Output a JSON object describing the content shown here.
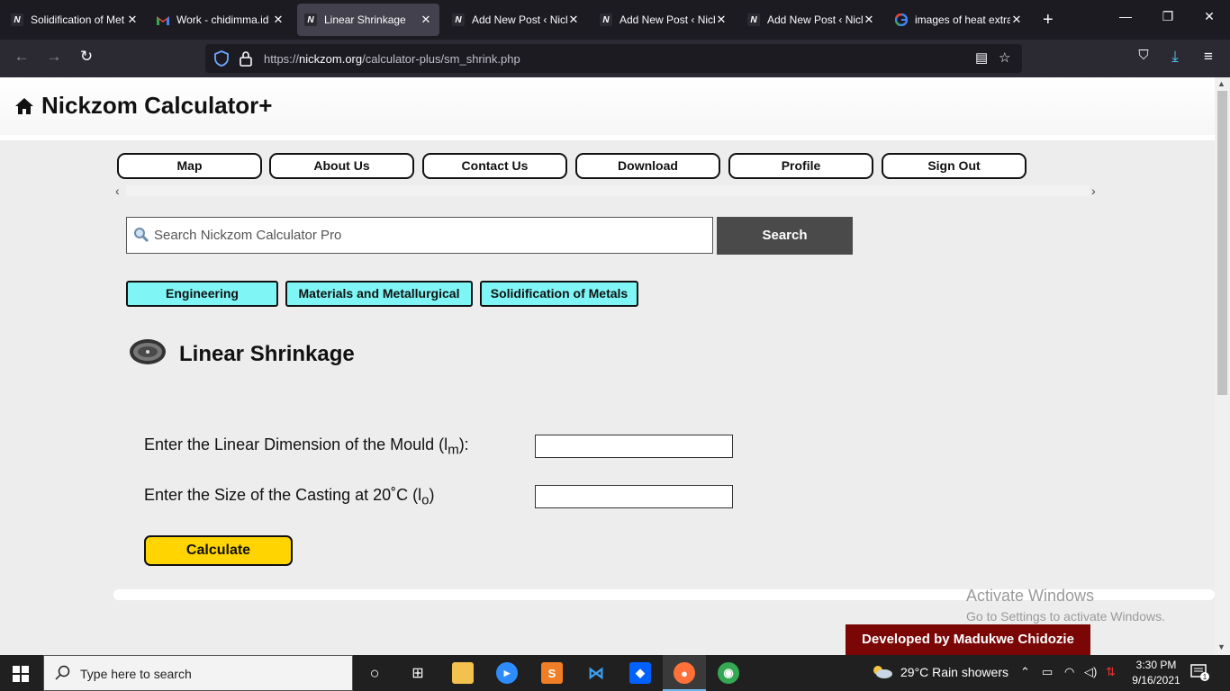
{
  "browser": {
    "tabs": [
      {
        "title": "Solidification of Met",
        "favicon": "nickzom"
      },
      {
        "title": "Work - chidimma.id",
        "favicon": "gmail"
      },
      {
        "title": "Linear Shrinkage",
        "favicon": "nickzom",
        "active": true
      },
      {
        "title": "Add New Post ‹ Nicl",
        "favicon": "nickzom"
      },
      {
        "title": "Add New Post ‹ Nicl",
        "favicon": "nickzom"
      },
      {
        "title": "Add New Post ‹ Nicl",
        "favicon": "nickzom"
      },
      {
        "title": "images of heat extra",
        "favicon": "google"
      }
    ],
    "url_prefix": "https://",
    "url_host": "nickzom.org",
    "url_path": "/calculator-plus/sm_shrink.php"
  },
  "site": {
    "title": "Nickzom Calculator+"
  },
  "menu": [
    "Map",
    "About Us",
    "Contact Us",
    "Download",
    "Profile",
    "Sign Out"
  ],
  "search": {
    "placeholder": "Search Nickzom Calculator Pro",
    "button": "Search"
  },
  "breadcrumbs": [
    "Engineering",
    "Materials and Metallurgical",
    "Solidification of Metals"
  ],
  "calculator": {
    "title": "Linear Shrinkage",
    "field1_label": "Enter the Linear Dimension of the Mould (l",
    "field1_sub": "m",
    "field1_tail": "):",
    "field2_label": "Enter the Size of the Casting at 20˚C (l",
    "field2_sub": "o",
    "field2_tail": ")",
    "calculate": "Calculate"
  },
  "watermark": {
    "line1": "Activate Windows",
    "line2": "Go to Settings to activate Windows."
  },
  "developer": "Developed by Madukwe Chidozie",
  "taskbar": {
    "search_placeholder": "Type here to search",
    "weather": "29°C  Rain showers",
    "time": "3:30 PM",
    "date": "9/16/2021",
    "notification_count": "1"
  },
  "colors": {
    "breadcrumb_bg": "#7ff5f5",
    "calculate_bg": "#ffd400",
    "developer_bg": "#7a0606",
    "search_button_bg": "#4a4a4a"
  }
}
